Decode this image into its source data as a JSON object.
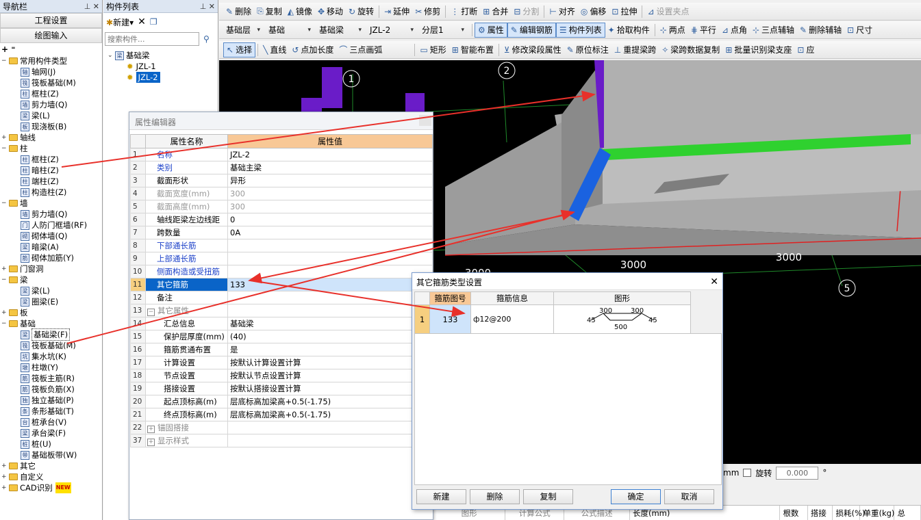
{
  "nav": {
    "title": "导航栏",
    "btn_project": "工程设置",
    "btn_draw": "绘图输入",
    "items": [
      {
        "label": "常用构件类型",
        "level": 0,
        "type": "folder",
        "exp": "−"
      },
      {
        "label": "轴网(J)",
        "level": 1,
        "type": "item",
        "icon": "轴"
      },
      {
        "label": "筏板基础(M)",
        "level": 1,
        "type": "item",
        "icon": "筏"
      },
      {
        "label": "框柱(Z)",
        "level": 1,
        "type": "item",
        "icon": "柱"
      },
      {
        "label": "剪力墙(Q)",
        "level": 1,
        "type": "item",
        "icon": "墙"
      },
      {
        "label": "梁(L)",
        "level": 1,
        "type": "item",
        "icon": "梁"
      },
      {
        "label": "现浇板(B)",
        "level": 1,
        "type": "item",
        "icon": "板"
      },
      {
        "label": "轴线",
        "level": 0,
        "type": "folder",
        "exp": "+"
      },
      {
        "label": "柱",
        "level": 0,
        "type": "folder",
        "exp": "−"
      },
      {
        "label": "框柱(Z)",
        "level": 1,
        "type": "item",
        "icon": "柱"
      },
      {
        "label": "暗柱(Z)",
        "level": 1,
        "type": "item",
        "icon": "柱"
      },
      {
        "label": "端柱(Z)",
        "level": 1,
        "type": "item",
        "icon": "柱"
      },
      {
        "label": "构造柱(Z)",
        "level": 1,
        "type": "item",
        "icon": "柱"
      },
      {
        "label": "墙",
        "level": 0,
        "type": "folder",
        "exp": "−"
      },
      {
        "label": "剪力墙(Q)",
        "level": 1,
        "type": "item",
        "icon": "墙"
      },
      {
        "label": "人防门框墙(RF)",
        "level": 1,
        "type": "item",
        "icon": "门"
      },
      {
        "label": "砌体墙(Q)",
        "level": 1,
        "type": "item",
        "icon": "砌"
      },
      {
        "label": "暗梁(A)",
        "level": 1,
        "type": "item",
        "icon": "梁"
      },
      {
        "label": "砌体加筋(Y)",
        "level": 1,
        "type": "item",
        "icon": "筋"
      },
      {
        "label": "门窗洞",
        "level": 0,
        "type": "folder",
        "exp": "+"
      },
      {
        "label": "梁",
        "level": 0,
        "type": "folder",
        "exp": "−"
      },
      {
        "label": "梁(L)",
        "level": 1,
        "type": "item",
        "icon": "梁"
      },
      {
        "label": "圈梁(E)",
        "level": 1,
        "type": "item",
        "icon": "梁"
      },
      {
        "label": "板",
        "level": 0,
        "type": "folder",
        "exp": "+"
      },
      {
        "label": "基础",
        "level": 0,
        "type": "folder",
        "exp": "−"
      },
      {
        "label": "基础梁(F)",
        "level": 1,
        "type": "item",
        "icon": "梁",
        "selected": true
      },
      {
        "label": "筏板基础(M)",
        "level": 1,
        "type": "item",
        "icon": "筏"
      },
      {
        "label": "集水坑(K)",
        "level": 1,
        "type": "item",
        "icon": "坑"
      },
      {
        "label": "柱墩(Y)",
        "level": 1,
        "type": "item",
        "icon": "墩"
      },
      {
        "label": "筏板主筋(R)",
        "level": 1,
        "type": "item",
        "icon": "筋"
      },
      {
        "label": "筏板负筋(X)",
        "level": 1,
        "type": "item",
        "icon": "筋"
      },
      {
        "label": "独立基础(P)",
        "level": 1,
        "type": "item",
        "icon": "独"
      },
      {
        "label": "条形基础(T)",
        "level": 1,
        "type": "item",
        "icon": "条"
      },
      {
        "label": "桩承台(V)",
        "level": 1,
        "type": "item",
        "icon": "台"
      },
      {
        "label": "承台梁(F)",
        "level": 1,
        "type": "item",
        "icon": "梁"
      },
      {
        "label": "桩(U)",
        "level": 1,
        "type": "item",
        "icon": "桩"
      },
      {
        "label": "基础板带(W)",
        "level": 1,
        "type": "item",
        "icon": "带"
      },
      {
        "label": "其它",
        "level": 0,
        "type": "folder",
        "exp": "+"
      },
      {
        "label": "自定义",
        "level": 0,
        "type": "folder",
        "exp": "+"
      },
      {
        "label": "CAD识别",
        "level": 0,
        "type": "folder",
        "exp": "+",
        "badge": "NEW"
      }
    ]
  },
  "comp": {
    "title": "构件列表",
    "new_label": "新建",
    "search_placeholder": "搜索构件...",
    "root": "基础梁",
    "children": [
      "JZL-1",
      "JZL-2"
    ]
  },
  "toolbar1": [
    "删除",
    "复制",
    "镜像",
    "移动",
    "旋转",
    "延伸",
    "修剪",
    "打断",
    "合并",
    "分割",
    "对齐",
    "偏移",
    "拉伸",
    "设置夹点"
  ],
  "toolbar2": {
    "dropdowns": [
      "基础层",
      "基础",
      "基础梁",
      "JZL-2",
      "分层1"
    ],
    "buttons": [
      "属性",
      "编辑钢筋",
      "构件列表",
      "拾取构件",
      "两点",
      "平行",
      "点角",
      "三点辅轴",
      "删除辅轴",
      "尺寸"
    ]
  },
  "toolbar3": [
    "选择",
    "直线",
    "点加长度",
    "三点画弧",
    "矩形",
    "智能布置",
    "修改梁段属性",
    "原位标注",
    "重提梁跨",
    "梁跨数据复制",
    "批量识别梁支座",
    "应"
  ],
  "viewport": {
    "axis_labels": [
      "1",
      "2",
      "5"
    ],
    "dims": [
      "3000",
      "3000",
      "3000"
    ]
  },
  "prop": {
    "title": "属性编辑器",
    "col_name": "属性名称",
    "col_value": "属性值",
    "rows": [
      {
        "n": "1",
        "name": "名称",
        "value": "JZL-2",
        "style": "blue"
      },
      {
        "n": "2",
        "name": "类别",
        "value": "基础主梁",
        "style": "blue"
      },
      {
        "n": "3",
        "name": "截面形状",
        "value": "异形",
        "style": ""
      },
      {
        "n": "4",
        "name": "截面宽度(mm)",
        "value": "300",
        "style": "gray"
      },
      {
        "n": "5",
        "name": "截面高度(mm)",
        "value": "300",
        "style": "gray"
      },
      {
        "n": "6",
        "name": "轴线距梁左边线距",
        "value": "0",
        "style": ""
      },
      {
        "n": "7",
        "name": "跨数量",
        "value": "0A",
        "style": ""
      },
      {
        "n": "8",
        "name": "下部通长筋",
        "value": "",
        "style": "blue"
      },
      {
        "n": "9",
        "name": "上部通长筋",
        "value": "",
        "style": "blue"
      },
      {
        "n": "10",
        "name": "侧面构造或受扭筋",
        "value": "",
        "style": "blue"
      },
      {
        "n": "11",
        "name": "其它箍筋",
        "value": "133",
        "style": "sel"
      },
      {
        "n": "12",
        "name": "备注",
        "value": "",
        "style": ""
      },
      {
        "n": "13",
        "name": "其它属性",
        "value": "",
        "style": "group",
        "exp": "−"
      },
      {
        "n": "14",
        "name": "汇总信息",
        "value": "基础梁",
        "style": "sub"
      },
      {
        "n": "15",
        "name": "保护层厚度(mm)",
        "value": "(40)",
        "style": "sub"
      },
      {
        "n": "16",
        "name": "箍筋贯通布置",
        "value": "是",
        "style": "sub"
      },
      {
        "n": "17",
        "name": "计算设置",
        "value": "按默认计算设置计算",
        "style": "sub"
      },
      {
        "n": "18",
        "name": "节点设置",
        "value": "按默认节点设置计算",
        "style": "sub"
      },
      {
        "n": "19",
        "name": "搭接设置",
        "value": "按默认搭接设置计算",
        "style": "sub"
      },
      {
        "n": "20",
        "name": "起点顶标高(m)",
        "value": "层底标高加梁高+0.5(-1.75)",
        "style": "sub"
      },
      {
        "n": "21",
        "name": "终点顶标高(m)",
        "value": "层底标高加梁高+0.5(-1.75)",
        "style": "sub"
      },
      {
        "n": "22",
        "name": "锚固搭接",
        "value": "",
        "style": "group",
        "exp": "+"
      },
      {
        "n": "37",
        "name": "显示样式",
        "value": "",
        "style": "group",
        "exp": "+"
      }
    ]
  },
  "dlg": {
    "title": "其它箍筋类型设置",
    "col_code": "箍筋图号",
    "col_info": "箍筋信息",
    "col_shape": "图形",
    "row": {
      "n": "1",
      "code": "133",
      "info": "ф12@200",
      "s1": "300",
      "s2": "300",
      "s3": "500",
      "a1": "45",
      "a2": "45"
    },
    "btn_new": "新建",
    "btn_delete": "删除",
    "btn_copy": "复制",
    "btn_ok": "确定",
    "btn_cancel": "取消"
  },
  "status": {
    "unit": "mm",
    "rotate_label": "旋转",
    "rotate_value": "0.000",
    "degree": "°"
  },
  "bottom_cols": [
    "图形",
    "计算公式",
    "公式描述",
    "长度(mm)",
    "根数",
    "搭接",
    "损耗(%)",
    "单重(kg)",
    "总"
  ]
}
